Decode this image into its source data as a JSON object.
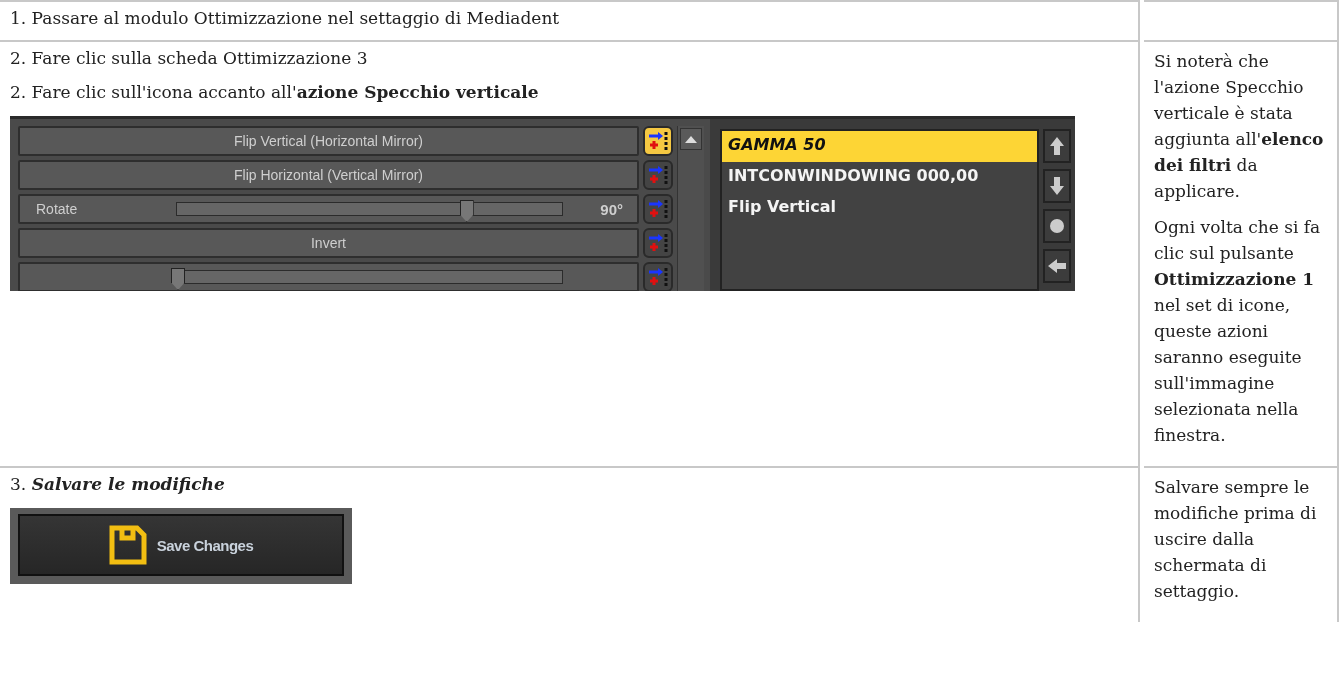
{
  "sections": [
    {
      "instructions": [
        {
          "text": "1. Passare al modulo Ottimizzazione nel settaggio di Mediadent"
        }
      ]
    },
    {
      "instructions": [
        {
          "text": "2. Fare clic sulla scheda Ottimizzazione 3"
        },
        {
          "text": "2. Fare clic sull'icona accanto all'**azione Specchio verticale**"
        }
      ],
      "screenshot": {
        "kind": "filter_panel",
        "actions": [
          {
            "kind": "button",
            "label": "Flip Vertical (Horizontal Mirror)",
            "highlighted": true
          },
          {
            "kind": "button",
            "label": "Flip Horizontal (Vertical Mirror)",
            "highlighted": false
          },
          {
            "kind": "slider",
            "label": "Rotate",
            "level": 0.75,
            "reading": "90°",
            "highlighted": false
          },
          {
            "kind": "button",
            "label": "Invert",
            "highlighted": false
          },
          {
            "kind": "slider",
            "level": 0,
            "highlighted": false
          }
        ],
        "filters": [
          {
            "text": "GAMMA 50",
            "selected": true
          },
          {
            "text": "INTCONWINDOWING 000,00",
            "selected": false
          },
          {
            "text": "Flip Vertical",
            "selected": false
          }
        ]
      },
      "notes": [
        "Si noterà che l'azione Specchio verticale è stata aggiunta all'**elenco dei filtri** da applicare.",
        "Ogni volta che si fa clic sul pulsante **Ottimizzazione 1** nel set di icone, queste azioni saranno eseguite sull'immagine selezionata nella finestra."
      ]
    },
    {
      "instructions": [
        {
          "number": "3.",
          "title": "Salvare le modifiche"
        }
      ],
      "screenshot": {
        "kind": "save_button",
        "label": "Save Changes"
      },
      "notes": [
        "Salvare sempre le modifiche prima di uscire dalla schermata di settaggio."
      ]
    }
  ]
}
